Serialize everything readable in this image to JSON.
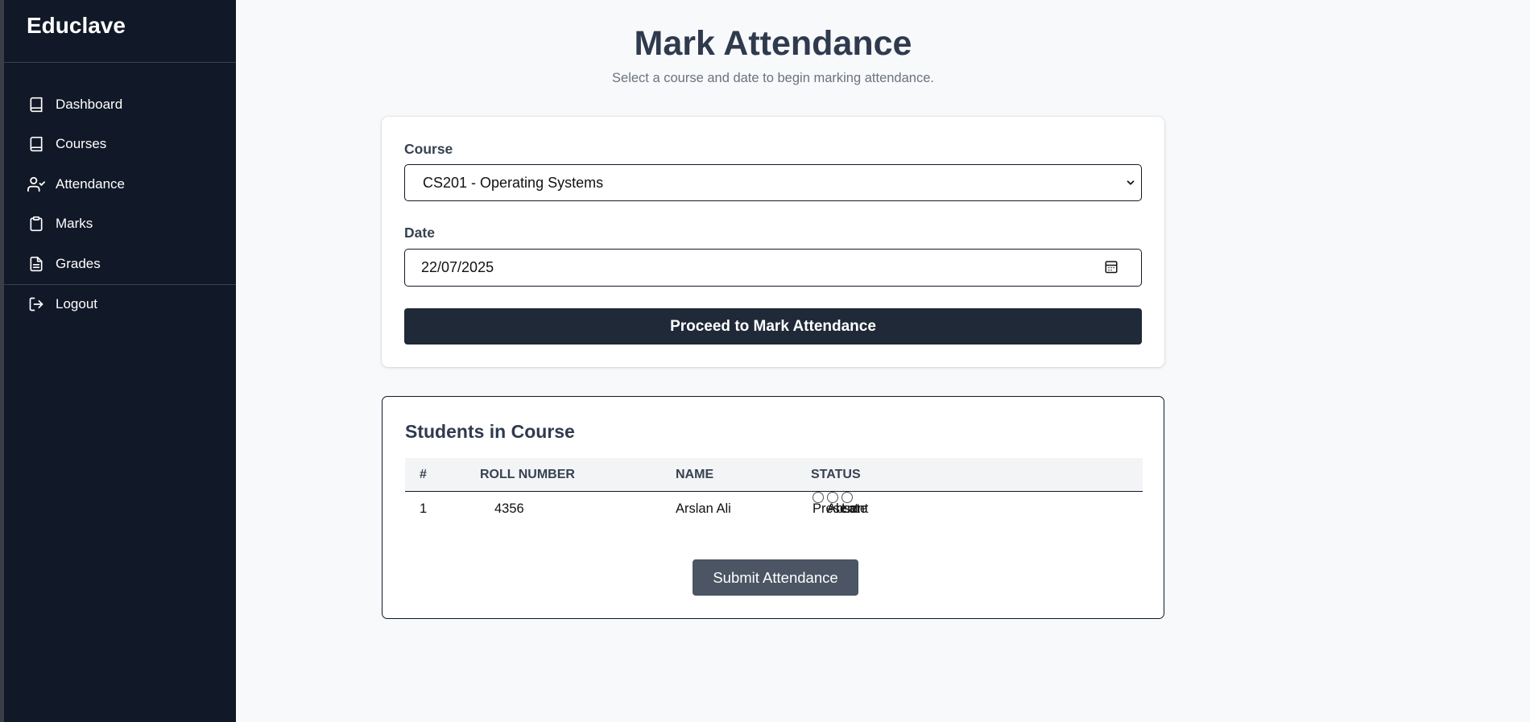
{
  "app": {
    "brand": "Educlave"
  },
  "sidebar": {
    "items": [
      {
        "label": "Dashboard",
        "icon": "book-icon"
      },
      {
        "label": "Courses",
        "icon": "book-icon"
      },
      {
        "label": "Attendance",
        "icon": "user-check-icon"
      },
      {
        "label": "Marks",
        "icon": "clipboard-icon"
      },
      {
        "label": "Grades",
        "icon": "document-icon"
      }
    ],
    "logout": {
      "label": "Logout",
      "icon": "logout-icon"
    }
  },
  "page": {
    "title": "Mark Attendance",
    "subtitle": "Select a course and date to begin marking attendance."
  },
  "form": {
    "course_label": "Course",
    "course_value": "CS201 - Operating Systems",
    "date_label": "Date",
    "date_value": "22/07/2025",
    "proceed_label": "Proceed to Mark Attendance"
  },
  "students": {
    "title": "Students in Course",
    "columns": [
      "#",
      "ROLL NUMBER",
      "NAME",
      "STATUS"
    ],
    "rows": [
      {
        "index": "1",
        "roll": "4356",
        "name": "Arslan Ali"
      }
    ],
    "status_options": [
      "Present",
      "Absent",
      "Late"
    ],
    "submit_label": "Submit Attendance"
  },
  "colors": {
    "sidebar_bg": "#111827",
    "primary_button": "#1f2937",
    "submit_button": "#4b5563",
    "page_bg": "#f8f9fb"
  }
}
